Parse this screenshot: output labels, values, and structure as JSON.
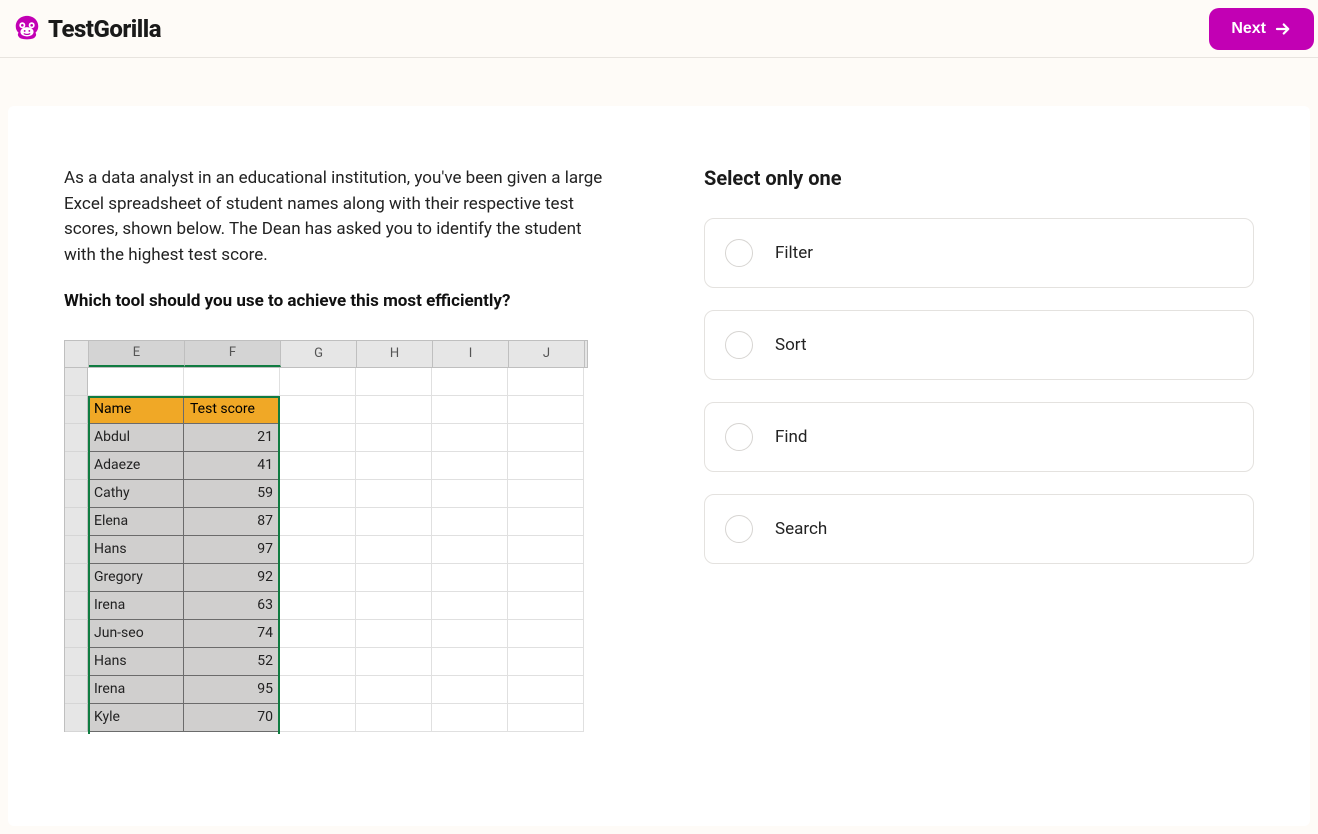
{
  "header": {
    "brand": "TestGorilla",
    "next_label": "Next"
  },
  "question": {
    "context": "As a data analyst in an educational institution, you've been given a large Excel spreadsheet of student names along with their respective test scores, shown below. The Dean has asked you to identify the student with the highest test score.",
    "prompt": "Which tool should you use to achieve this most efficiently?"
  },
  "excel": {
    "columns": [
      "E",
      "F",
      "G",
      "H",
      "I",
      "J"
    ],
    "header_name": "Name",
    "header_score": "Test score",
    "rows": [
      {
        "name": "Abdul",
        "score": "21"
      },
      {
        "name": "Adaeze",
        "score": "41"
      },
      {
        "name": "Cathy",
        "score": "59"
      },
      {
        "name": "Elena",
        "score": "87"
      },
      {
        "name": "Hans",
        "score": "97"
      },
      {
        "name": "Gregory",
        "score": "92"
      },
      {
        "name": "Irena",
        "score": "63"
      },
      {
        "name": "Jun-seo",
        "score": "74"
      },
      {
        "name": "Hans",
        "score": "52"
      },
      {
        "name": "Irena",
        "score": "95"
      },
      {
        "name": "Kyle",
        "score": "70"
      }
    ]
  },
  "answers": {
    "instruction": "Select only one",
    "options": [
      {
        "label": "Filter"
      },
      {
        "label": "Sort"
      },
      {
        "label": "Find"
      },
      {
        "label": "Search"
      }
    ]
  }
}
